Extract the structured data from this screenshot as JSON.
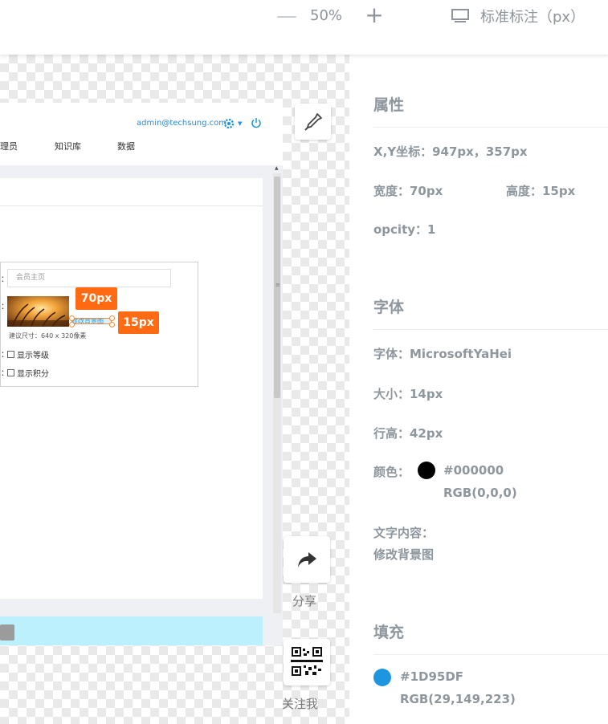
{
  "toolbar": {
    "zoom_minus": "—",
    "zoom_value": "50%",
    "zoom_plus": "+",
    "mode_icon": "monitor-icon",
    "mode_label": "标准标注（px）"
  },
  "design": {
    "admin_email": "admin@techsung.com",
    "nav": [
      "理员",
      "知识库",
      "数据"
    ],
    "colon": "：",
    "page_input_placeholder": "会员主页",
    "modify_link": "修改背景图",
    "size_hint": "建议尺寸：640 x 320像素",
    "check_level": "显示等级",
    "check_points": "显示积分",
    "width_tag": "70px",
    "height_tag": "15px"
  },
  "tools": {
    "share_label": "分享",
    "qr_label": "关注我"
  },
  "info": {
    "attr_title": "属性",
    "xy": "X,Y坐标：947px，357px",
    "width": "宽度：70px",
    "height": "高度：15px",
    "opacity": "opcity：1",
    "font_title": "字体",
    "font_family": "字体：MicrosoftYaHei",
    "font_size": "大小：14px",
    "line_height": "行高：42px",
    "color_label": "颜色：",
    "text_color_hex": "#000000",
    "text_color_rgb": "RGB(0,0,0)",
    "text_content_label": "文字内容：",
    "text_content": "修改背景图",
    "fill_title": "填充",
    "fill_hex": "#1D95DF",
    "fill_rgb": "RGB(29,149,223)"
  },
  "colors": {
    "accent": "#1D95DF",
    "text_swatch": "#000000",
    "tag": "#FF6A13",
    "footer": "#BDF0FD"
  }
}
